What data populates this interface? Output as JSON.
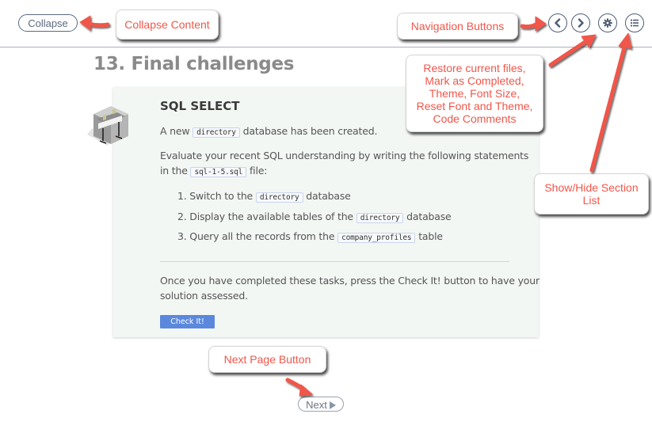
{
  "toolbar": {
    "collapse_label": "Collapse",
    "prev_icon": "chevron-left-icon",
    "next_icon": "chevron-right-icon",
    "settings_icon": "gear-icon",
    "sections_icon": "list-icon"
  },
  "page": {
    "title": "13. Final challenges"
  },
  "challenge": {
    "title": "SQL SELECT",
    "intro_prefix": "A new",
    "intro_code": "directory",
    "intro_suffix": "database has been created.",
    "eval_line1": "Evaluate your recent SQL understanding by writing the following statements",
    "eval_line2_prefix": "in the",
    "eval_line2_code": "sql-1-5.sql",
    "eval_line2_suffix": "file:",
    "tasks": [
      {
        "prefix": "1. Switch to the",
        "code": "directory",
        "suffix": "database"
      },
      {
        "prefix": "2. Display the available tables of the",
        "code": "directory",
        "suffix": "database"
      },
      {
        "prefix": "3. Query all the records from the",
        "code": "company_profiles",
        "suffix": "table"
      }
    ],
    "outro_line1": "Once you have completed these tasks, press the Check It! button to have your",
    "outro_line2": "solution assessed.",
    "check_button": "Check It!",
    "check_button_color": "#5b88dd"
  },
  "footer": {
    "next_label": "Next"
  },
  "callouts": {
    "collapse": "Collapse Content",
    "navigation": "Navigation Buttons",
    "settings_lines": [
      "Restore current files,",
      "Mark as Completed,",
      "Theme, Font Size,",
      "Reset Font and Theme,",
      "Code Comments"
    ],
    "sections_lines": [
      "Show/Hide Section",
      "List"
    ],
    "next_page": "Next Page Button",
    "text_color": "#f0564a",
    "arrow_color": "#f0564a"
  }
}
